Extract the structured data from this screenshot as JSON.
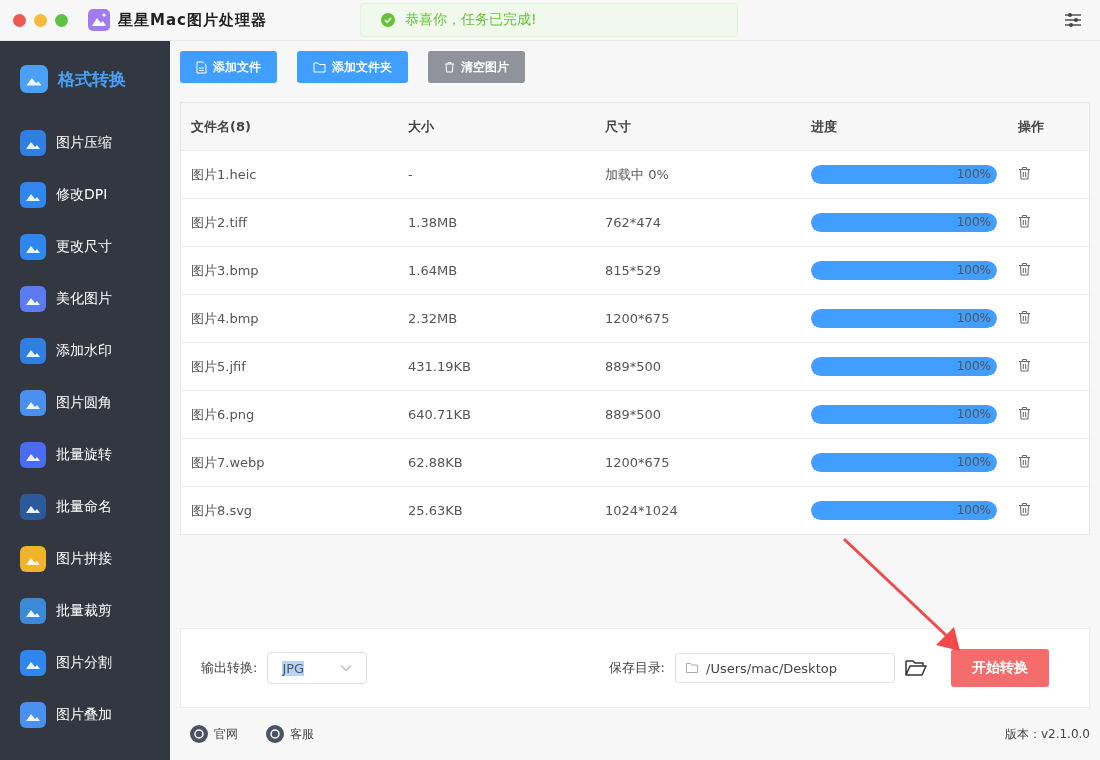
{
  "window": {
    "title": "星星Mac图片处理器"
  },
  "toast": {
    "message": "恭喜你，任务已完成!"
  },
  "sidebar": {
    "items": [
      {
        "label": "格式转换",
        "selected": true
      },
      {
        "label": "图片压缩",
        "selected": false
      },
      {
        "label": "修改DPI",
        "selected": false
      },
      {
        "label": "更改尺寸",
        "selected": false
      },
      {
        "label": "美化图片",
        "selected": false
      },
      {
        "label": "添加水印",
        "selected": false
      },
      {
        "label": "图片圆角",
        "selected": false
      },
      {
        "label": "批量旋转",
        "selected": false
      },
      {
        "label": "批量命名",
        "selected": false
      },
      {
        "label": "图片拼接",
        "selected": false
      },
      {
        "label": "批量裁剪",
        "selected": false
      },
      {
        "label": "图片分割",
        "selected": false
      },
      {
        "label": "图片叠加",
        "selected": false
      }
    ]
  },
  "toolbar": [
    {
      "label": "添加文件",
      "kind": "file"
    },
    {
      "label": "添加文件夹",
      "kind": "folder"
    },
    {
      "label": "清空图片",
      "kind": "clear"
    }
  ],
  "table": {
    "columns": [
      "文件名(8)",
      "大小",
      "尺寸",
      "进度",
      "操作"
    ],
    "rows": [
      {
        "name": "图片1.heic",
        "size": "-",
        "dims": "加载中 0%",
        "level": 1,
        "reading": "100%"
      },
      {
        "name": "图片2.tiff",
        "size": "1.38MB",
        "dims": "762*474",
        "level": 1,
        "reading": "100%"
      },
      {
        "name": "图片3.bmp",
        "size": "1.64MB",
        "dims": "815*529",
        "level": 1,
        "reading": "100%"
      },
      {
        "name": "图片4.bmp",
        "size": "2.32MB",
        "dims": "1200*675",
        "level": 1,
        "reading": "100%"
      },
      {
        "name": "图片5.jfif",
        "size": "431.19KB",
        "dims": "889*500",
        "level": 1,
        "reading": "100%"
      },
      {
        "name": "图片6.png",
        "size": "640.71KB",
        "dims": "889*500",
        "level": 1,
        "reading": "100%"
      },
      {
        "name": "图片7.webp",
        "size": "62.88KB",
        "dims": "1200*675",
        "level": 1,
        "reading": "100%"
      },
      {
        "name": "图片8.svg",
        "size": "25.63KB",
        "dims": "1024*1024",
        "level": 1,
        "reading": "100%"
      }
    ]
  },
  "output": {
    "label": "输出转换:",
    "format": "JPG",
    "save_label": "保存目录:",
    "path": "/Users/mac/Desktop",
    "start": "开始转换"
  },
  "footer": {
    "links": [
      "官网",
      "客服"
    ],
    "version": "版本：v2.1.0.0"
  }
}
